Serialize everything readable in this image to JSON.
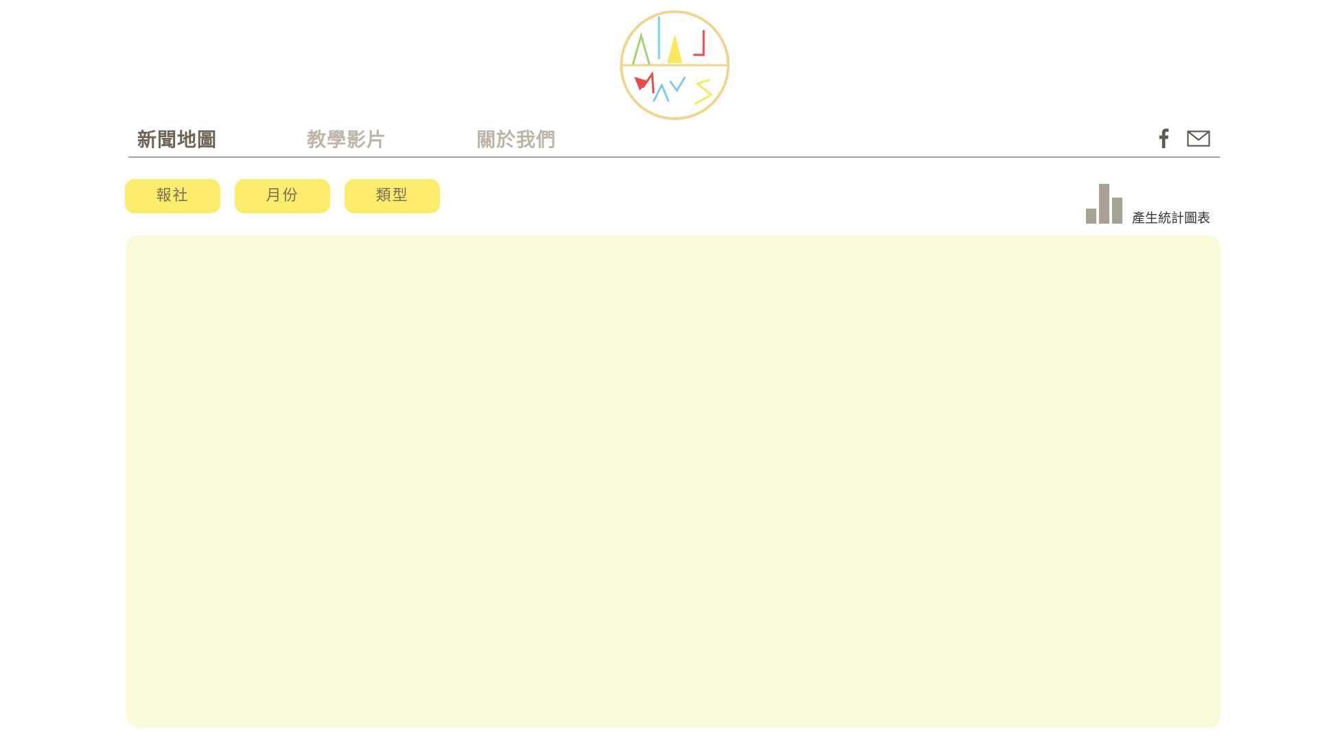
{
  "logo": {
    "text_top": "ALL",
    "text_bottom": "WAYS",
    "colors": {
      "ring": "#f2d58c",
      "yellow": "#f8e85c",
      "blue": "#7dcbe9",
      "green": "#9fd56e",
      "red": "#e64a4a"
    }
  },
  "nav": {
    "items": [
      {
        "label": "新聞地圖",
        "active": true
      },
      {
        "label": "教學影片",
        "active": false
      },
      {
        "label": "關於我們",
        "active": false
      }
    ],
    "facebook_icon": "facebook-icon",
    "mail_icon": "mail-icon"
  },
  "filters": {
    "newspaper": "報社",
    "month": "月份",
    "type": "類型"
  },
  "stats": {
    "label": "產生統計圖表",
    "icon": "bar-chart-icon"
  },
  "colors": {
    "accent_yellow": "#fbec6b",
    "map_bg": "#fbfad8",
    "nav_active": "#6e6455",
    "nav_inactive": "#bdb5a6",
    "icon_gray": "#a8a294"
  }
}
